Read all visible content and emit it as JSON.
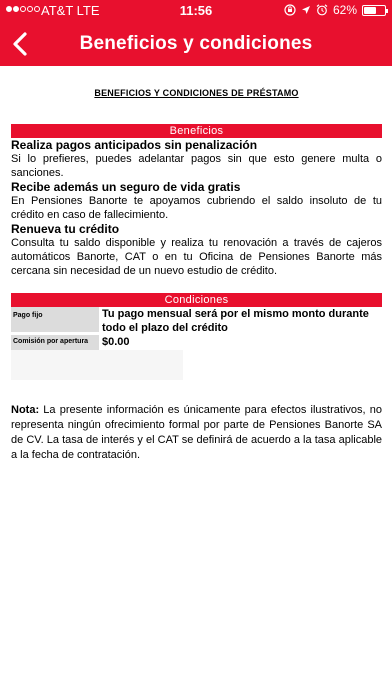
{
  "status_bar": {
    "carrier": "AT&T  LTE",
    "time": "11:56",
    "battery_percent": "62%",
    "battery_level": 0.62,
    "signal_bars_filled": 2,
    "signal_bars_total": 5
  },
  "nav": {
    "title": "Beneficios y condiciones",
    "bar_color": "#e8102e"
  },
  "document": {
    "title": "BENEFICIOS Y CONDICIONES DE PRÉSTAMO",
    "beneficios": {
      "header": "Beneficios",
      "items": [
        {
          "heading": "Realiza pagos anticipados sin penalización",
          "text": "Si lo prefieres, puedes adelantar pagos sin que esto genere multa o sanciones."
        },
        {
          "heading": "Recibe además un seguro de vida gratis",
          "text": "En Pensiones Banorte te apoyamos cubriendo el saldo insoluto de tu crédito en caso de fallecimiento."
        },
        {
          "heading": "Renueva tu crédito",
          "text": "Consulta tu saldo disponible y realiza tu renovación a través de cajeros automáticos Banorte, CAT o en tu Oficina de Pensiones Banorte más cercana sin necesidad de un nuevo estudio de crédito."
        }
      ]
    },
    "condiciones": {
      "header": "Condiciones",
      "rows": [
        {
          "label": "Pago fijo",
          "value": "Tu pago mensual será por el mismo monto durante todo el plazo del crédito"
        },
        {
          "label": "Comisión por apertura",
          "value": "$0.00"
        }
      ]
    },
    "note": {
      "label": "Nota:",
      "text": " La presente información es únicamente para efectos ilustrativos, no representa ningún ofrecimiento formal por parte de Pensiones Banorte SA de CV. La tasa de interés y el CAT se definirá de acuerdo a la tasa aplicable a la fecha de contratación."
    }
  }
}
